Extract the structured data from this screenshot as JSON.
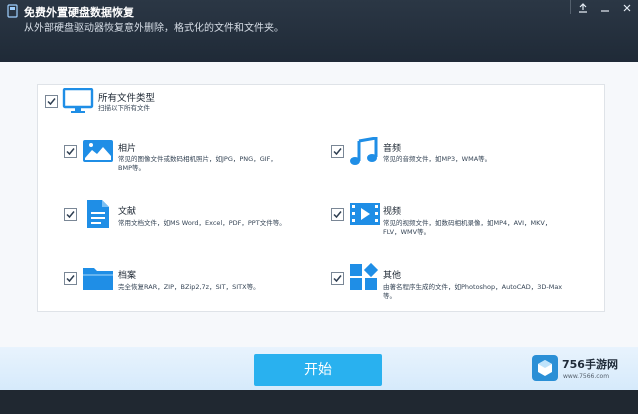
{
  "window": {
    "title": "免费外置硬盘数据恢复",
    "subtitle": "从外部硬盘驱动器恢复意外删除，格式化的文件和文件夹。",
    "controls": [
      "upload-icon",
      "minimize-icon",
      "close-icon"
    ]
  },
  "all_types": {
    "title": "所有文件类型",
    "subtitle": "扫描以下所有文件",
    "checked": true
  },
  "file_types": [
    {
      "id": "photos",
      "label": "相片",
      "desc_line1": "常见的图像文件或数码相机照片，如JPG，PNG，GIF，",
      "desc_line2": "BMP等。",
      "icon": "photo-icon",
      "checked": true
    },
    {
      "id": "audio",
      "label": "音频",
      "desc_line1": "常见的音频文件，如MP3，WMA等。",
      "desc_line2": "",
      "icon": "music-icon",
      "checked": true
    },
    {
      "id": "docs",
      "label": "文献",
      "desc_line1": "常用文档文件，如MS Word，Excel，PDF，PPT文件等。",
      "desc_line2": "",
      "icon": "document-icon",
      "checked": true
    },
    {
      "id": "video",
      "label": "视频",
      "desc_line1": "常见的视频文件，如数码相机录像，如MP4，AVI，MKV，",
      "desc_line2": "FLV，WMV等。",
      "icon": "video-icon",
      "checked": true
    },
    {
      "id": "archive",
      "label": "档案",
      "desc_line1": "完全恢复RAR，ZIP，BZip2,7z，SIT，SITX等。",
      "desc_line2": "",
      "icon": "folder-icon",
      "checked": true
    },
    {
      "id": "other",
      "label": "其他",
      "desc_line1": "由著名程序生成的文件，如Photoshop，AutoCAD，3D-Max",
      "desc_line2": "等。",
      "icon": "other-icon",
      "checked": true
    }
  ],
  "start_label": "开始",
  "watermark": {
    "brand": "756手游网",
    "url": "www.7566.com"
  },
  "colors": {
    "header": "#253140",
    "accent": "#29b1ef",
    "icon_blue": "#1f8ee6"
  }
}
